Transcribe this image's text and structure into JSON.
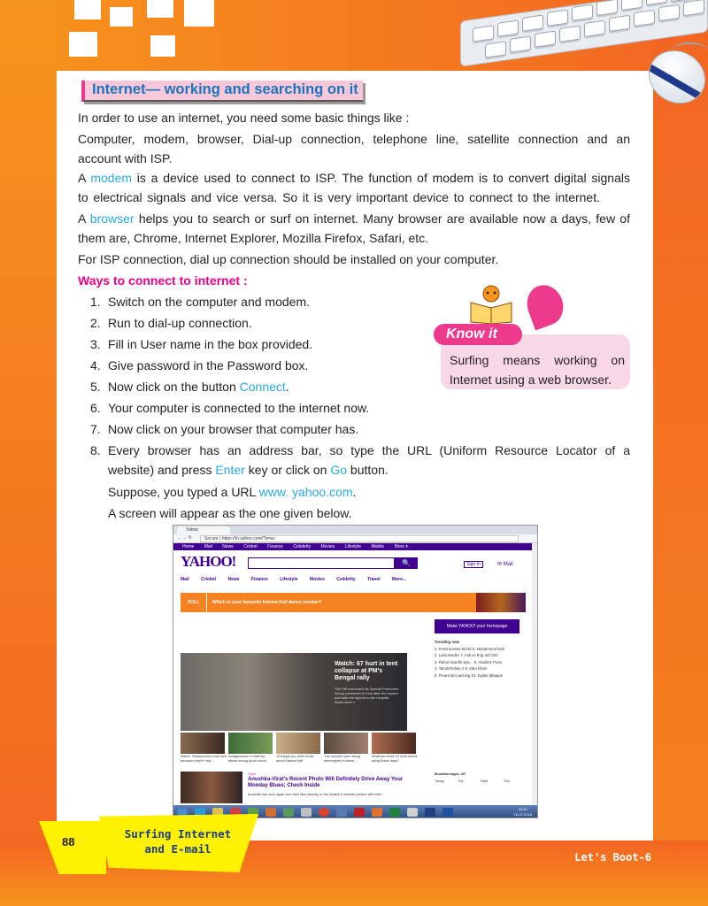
{
  "heading": "Internet— working and searching on it",
  "intro": "In order to use an internet, you need some basic things like :",
  "things_line1": "Computer, modem, browser, Dial-up connection, telephone line, satellite connection and an",
  "things_line2": "account with ISP.",
  "modem_a": "A ",
  "modem_word": "modem",
  "modem_line1_rest": " is a device used to connect to ISP. The function of modem is to convert digital signals",
  "modem_line2": "to electrical signals and vice versa. So it is very important device to connect to the internet.",
  "browser_a": "A ",
  "browser_word": "browser",
  "browser_line1_rest": " helps you to search or surf on internet. Many browser are available now a days, few of",
  "browser_line2": "them are, Chrome, Internet Explorer, Mozilla Firefox, Safari, etc.",
  "isp_line": "For ISP connection, dial up connection should be installed on your computer.",
  "ways_title": "Ways to connect to internet :",
  "steps": [
    {
      "n": "1.",
      "text": "Switch on the computer and modem."
    },
    {
      "n": "2.",
      "text": "Run to dial-up connection."
    },
    {
      "n": "3.",
      "text": "Fill in User name in the  box provided."
    },
    {
      "n": "4.",
      "text": "Give password in the Password box."
    },
    {
      "n": "5.",
      "text": "Now click on the button ",
      "hl": "Connect",
      "after": "."
    },
    {
      "n": "6.",
      "text": "Your computer is connected to the internet now."
    },
    {
      "n": "7.",
      "text": "Now click on your browser that computer has."
    }
  ],
  "step8": {
    "n": "8.",
    "line1": "Every browser has an address bar, so type the URL (Uniform  Resource Locator of a",
    "line2_a": "website) and press ",
    "line2_enter": "Enter",
    "line2_b": " key or  click on ",
    "line2_go": "Go",
    "line2_c": " button.",
    "line3_a": "Suppose, you typed a URL ",
    "line3_url": "www. yahoo.com",
    "line3_b": ".",
    "line4": "A screen will appear as the one given below."
  },
  "know_it": {
    "label": "Know it",
    "text": "Surfing means working on Internet using a web browser."
  },
  "screenshot": {
    "tab": "Yahoo",
    "url": "Secure | https://in.yahoo.com/?p=us",
    "top_nav": [
      "Home",
      "Mail",
      "News",
      "Cricket",
      "Finance",
      "Celebrity",
      "Movies",
      "Lifestyle",
      "Mobile",
      "More ▾"
    ],
    "logo": "YAHOO!",
    "search_btn": "🔍",
    "sign_in": "Sign In",
    "mail": "Mail",
    "sub_nav": [
      "Mail",
      "Cricket",
      "News",
      "Finance",
      "Lifestyle",
      "Movies",
      "Celebrity",
      "Travel",
      "More..."
    ],
    "poll_tag": "POLL",
    "poll_text": "Which is your favourite Katrina Kaif dance number?",
    "make_yahoo": "Make  YAHOO!  your homepage",
    "trending_title": "Trending now",
    "trending": [
      "1. Femina Miss World   6. Mohammed Kaif",
      "2. Luka Modric           7. Indi vs Eng 3rd ODI",
      "3. Rahul Gandhi Spe...  8. Vladimir Putin",
      "4. Tamilt Rohan 2        9. Irfan Khan",
      "5. Financial coaching  10. Kylian Mbappe"
    ],
    "hero_title": "Watch: 67 hurt in tent collapse at PM's Bengal rally",
    "hero_sub": "The PM instructed his Special Protection Group personnel to look after the injured and take the injured to the hospital.",
    "hero_more": "Read more »",
    "thumb_caps": [
      "Watch: Obama rises a tall race because they're only ...",
      "Instagrammer a bitter by abuse during photo shoot",
      "10 things you didn't know about Katrina Kaif",
      "'You wouldn't dare being stereotyped in these...",
      "What are these 10 child actors doing these days?"
    ],
    "story_tag": "Style",
    "story_title": "Anushka-Virat's Recent Photo Will Definitely Drive Away Your Monday Blues; Check Inside",
    "story_desc": "Anushka has once again won their fans directly on the Instant a romantic picture with their ...",
    "weather_loc": "Muzaffarnagar, UP",
    "weather_days": [
      "Today",
      "Tue",
      "Wed",
      "Thu"
    ],
    "clock": "10:40\n16-07-2018"
  },
  "footer": {
    "page_number": "88",
    "chapter": "Surfing Internet and E-mail",
    "book": "Let's Boot-6"
  },
  "colors": {
    "orange": "#f26522",
    "pink": "#ec008c",
    "blue": "#27aae1",
    "heading_blue": "#1b75bc",
    "yahoo_purple": "#400090",
    "yellow": "#fff200"
  }
}
